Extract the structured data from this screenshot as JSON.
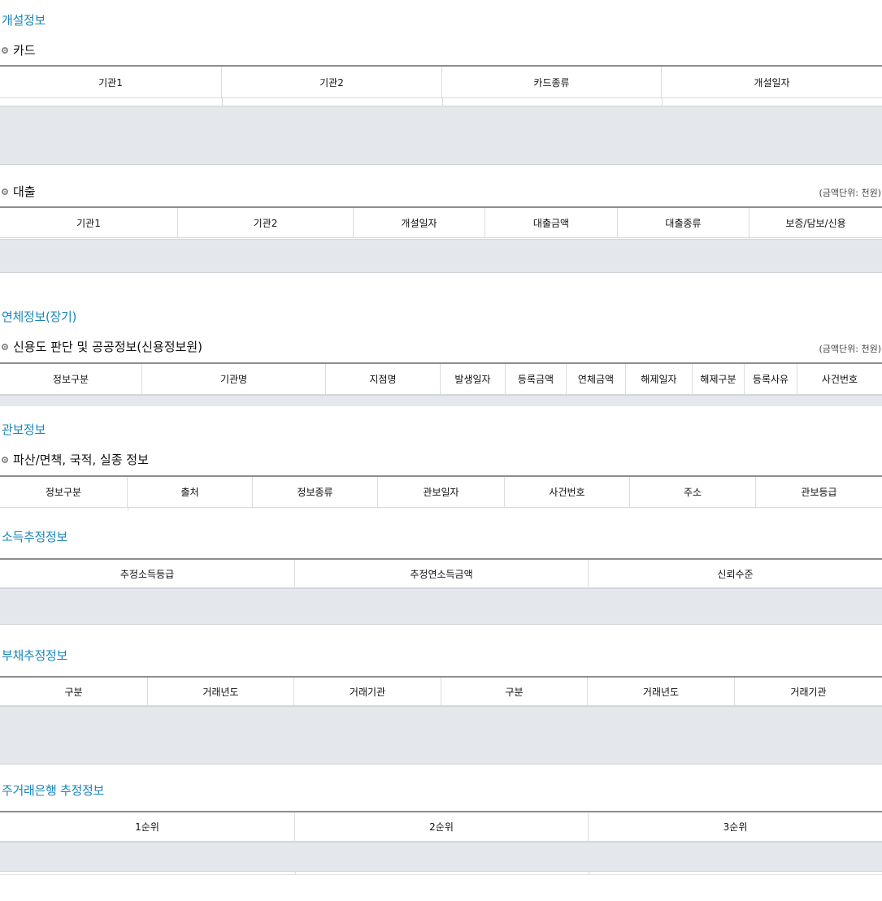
{
  "sections": {
    "opening": {
      "title": "개설정보",
      "card": {
        "sub": "카드",
        "headers": [
          "기관1",
          "기관2",
          "카드종류",
          "개설일자"
        ]
      },
      "loan": {
        "sub": "대출",
        "unit": "(금액단위: 천원)",
        "headers": [
          "기관1",
          "기관2",
          "개설일자",
          "대출금액",
          "대출종류",
          "보증/담보/신용"
        ]
      }
    },
    "delinquency": {
      "title": "연체정보(장기)",
      "public": {
        "sub": "신용도 판단 및 공공정보(신용정보원)",
        "unit": "(금액단위: 천원)",
        "headers": [
          "정보구분",
          "기관명",
          "지점명",
          "발생일자",
          "등록금액",
          "연체금액",
          "해제일자",
          "해제구분",
          "등록사유",
          "사건번호"
        ]
      }
    },
    "related": {
      "title": "관보정보",
      "bankrupt": {
        "sub": "파산/면책, 국적, 실종 정보",
        "headers": [
          "정보구분",
          "출처",
          "정보종류",
          "관보일자",
          "사건번호",
          "주소",
          "관보등급"
        ]
      }
    },
    "income": {
      "title": "소득추정정보",
      "headers": [
        "추정소득등급",
        "추정연소득금액",
        "신뢰수준"
      ]
    },
    "debt": {
      "title": "부채추정정보",
      "headers": [
        "구분",
        "거래년도",
        "거래기관",
        "구분",
        "거래년도",
        "거래기관"
      ]
    },
    "bank": {
      "title": "주거래은행 추정정보",
      "headers": [
        "1순위",
        "2순위",
        "3순위"
      ]
    }
  }
}
